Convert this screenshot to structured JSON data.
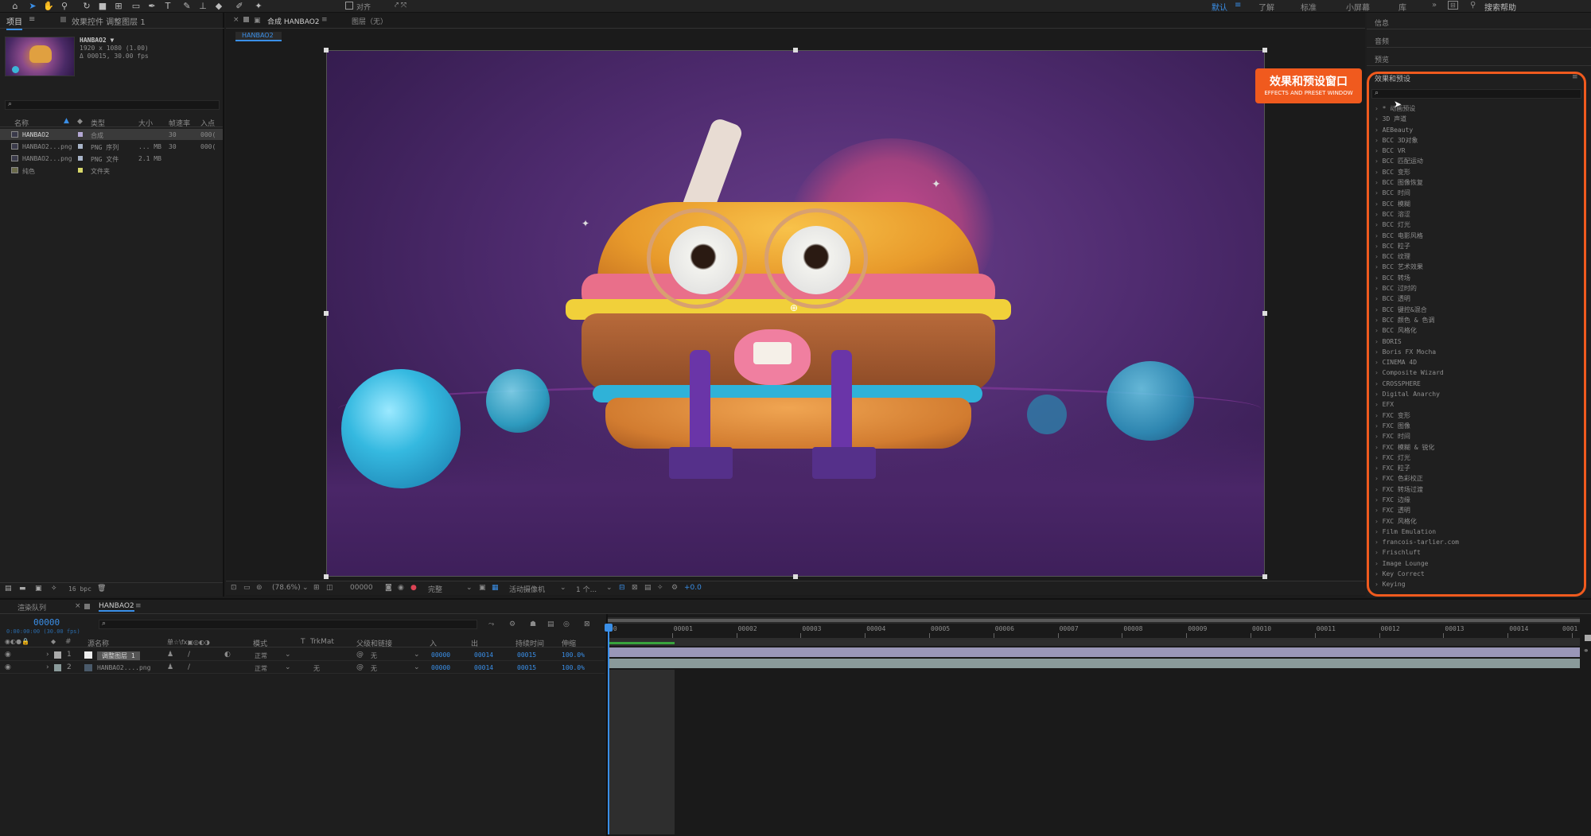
{
  "toolbar": {
    "snap_label": "对齐",
    "workspaces": [
      "默认",
      "了解",
      "标准",
      "小屏幕",
      "库"
    ],
    "search_help": "搜索帮助",
    "tool_icons": [
      "home-icon",
      "selection-tool-icon",
      "hand-tool-icon",
      "zoom-tool-icon",
      "rotate-tool-icon",
      "camera-tool-icon",
      "pan-behind-icon",
      "rectangle-tool-icon",
      "pen-tool-icon",
      "text-tool-icon",
      "brush-tool-icon",
      "clone-stamp-icon",
      "eraser-icon",
      "roto-brush-icon",
      "puppet-pin-icon"
    ]
  },
  "project": {
    "tab_project": "项目",
    "tab_effect_controls": "效果控件 调整图层 1",
    "comp_name": "HANBAO2 ▼",
    "comp_res": "1920 x 1080 (1.00)",
    "comp_dur": "Δ 00015, 30.00 fps",
    "search_icon": "⌕",
    "columns": [
      "名称",
      "类型",
      "大小",
      "帧速率",
      "入点"
    ],
    "items": [
      {
        "name": "HANBAO2",
        "type": "合成",
        "size": "",
        "fps": "30",
        "in": "000(",
        "color": "#b4a8d4"
      },
      {
        "name": "HANBAO2...png",
        "type": "PNG 序列",
        "size": "... MB",
        "fps": "30",
        "in": "000(",
        "color": "#a8b4c8"
      },
      {
        "name": "HANBAO2...png",
        "type": "PNG 文件",
        "size": "2.1 MB",
        "fps": "",
        "in": "",
        "color": "#a8b4c8"
      },
      {
        "name": "纯色",
        "type": "文件夹",
        "size": "",
        "fps": "",
        "in": "",
        "color": "#d8d86a"
      }
    ],
    "bpc": "16 bpc"
  },
  "viewer": {
    "tab_comp": "合成 HANBAO2",
    "tab_layer": "图层（无）",
    "subtab": "HANBAO2",
    "zoom": "(78.6%)",
    "timecode": "00000",
    "quality": "完整",
    "camera": "活动摄像机",
    "views": "1 个...",
    "exposure": "+0.0"
  },
  "overlay": {
    "title": "效果和预设窗口",
    "subtitle": "EFFECTS AND PRESET WINDOW",
    "color": "#f05a1e"
  },
  "right_panel": {
    "info": "信息",
    "audio": "音频",
    "preview": "预览",
    "fx_title": "效果和预设",
    "fx_items": [
      "* 动画预设",
      "3D 声道",
      "AEBeauty",
      "BCC 3D对象",
      "BCC VR",
      "BCC 匹配运动",
      "BCC 变形",
      "BCC 图像恢复",
      "BCC 时间",
      "BCC 模糊",
      "BCC 溶涩",
      "BCC 灯光",
      "BCC 电影风格",
      "BCC 粒子",
      "BCC 纹理",
      "BCC 艺术效果",
      "BCC 转场",
      "BCC 过时的",
      "BCC 透明",
      "BCC 键控&混合",
      "BCC 颜色 & 色调",
      "BCC 风格化",
      "BORIS",
      "Boris FX Mocha",
      "CINEMA 4D",
      "Composite Wizard",
      "CROSSPHERE",
      "Digital Anarchy",
      "EFX",
      "FXC 变形",
      "FXC 图像",
      "FXC 时间",
      "FXC 模糊 & 锐化",
      "FXC 灯光",
      "FXC 粒子",
      "FXC 色彩校正",
      "FXC 转场过渡",
      "FXC 边缘",
      "FXC 透明",
      "FXC 风格化",
      "Film Emulation",
      "francois-tarlier.com",
      "Frischluft",
      "Image Lounge",
      "Key Correct",
      "Keying"
    ]
  },
  "timeline": {
    "tab_render": "渲染队列",
    "tab_comp": "HANBAO2",
    "timecode": "00000",
    "timecode_sub": "0:00:00:00 (30.00 fps)",
    "headers": {
      "source": "源名称",
      "switches": "单☆\\fx▣◎◐◑",
      "mode": "模式",
      "t": "T",
      "trkmat": "TrkMat",
      "parent": "父级和链接",
      "in": "入",
      "out": "出",
      "duration": "持续时间",
      "stretch": "伸缩"
    },
    "layers": [
      {
        "num": "1",
        "name": "调整图层 1",
        "mode": "正常",
        "trkmat": "",
        "parent": "无",
        "in": "00000",
        "out": "00014",
        "duration": "00015",
        "stretch": "100.0%"
      },
      {
        "num": "2",
        "name": "HANBAO2....png",
        "mode": "正常",
        "trkmat": "无",
        "parent": "无",
        "in": "00000",
        "out": "00014",
        "duration": "00015",
        "stretch": "100.0%"
      }
    ],
    "ruler": [
      "00",
      "00001",
      "00002",
      "00003",
      "00004",
      "00005",
      "00006",
      "00007",
      "00008",
      "00009",
      "00010",
      "00011",
      "00012",
      "00013",
      "00014",
      "0001"
    ]
  }
}
